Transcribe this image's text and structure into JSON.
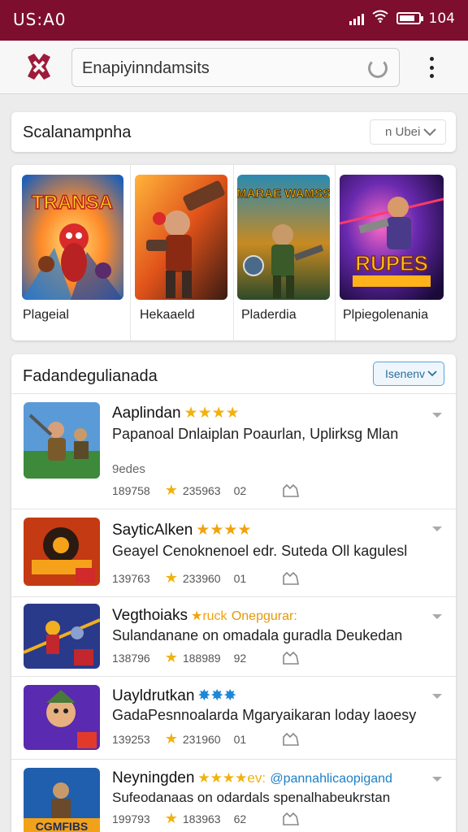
{
  "status_bar": {
    "time": "US:A0",
    "battery_text": "104"
  },
  "search": {
    "query": "Enapiyinndamsits"
  },
  "category": {
    "title": "Scalanampnha",
    "dropdown_label": "n Ubei"
  },
  "featured": [
    {
      "label": "Plageial",
      "art_title": "TRANSA",
      "palette": [
        "#1f7fd6",
        "#ff6b1a",
        "#d92b2b"
      ]
    },
    {
      "label": "Hekaaeld",
      "art_title": "",
      "palette": [
        "#f28a1a",
        "#8a2a12",
        "#3a2a22"
      ]
    },
    {
      "label": "Pladerdia",
      "art_title": "MARAE WAMSS",
      "palette": [
        "#1a6a8a",
        "#e0a020",
        "#2d5a2a"
      ]
    },
    {
      "label": "Plpiegolenania",
      "art_title": "RUPES",
      "palette": [
        "#3a1a6a",
        "#ff4db8",
        "#f5c21a"
      ]
    }
  ],
  "list": {
    "heading": "Fadandegulianada",
    "button_label": "Isenenv",
    "items": [
      {
        "name": "Aaplindan",
        "rating_text": "★★★★",
        "rating_color": "#f2b10c",
        "desc": "Papanoal Dnlaiplan Poaurlan, Uplirksg Mlan",
        "sub": "9edes",
        "downloads": "189758",
        "score": "235963",
        "version": "02",
        "thumb": [
          "#2e6ea6",
          "#7a5a2a",
          "#3c8a3a"
        ]
      },
      {
        "name": "SayticAlken",
        "rating_text": "★★★★",
        "rating_color": "#f2a20c",
        "desc": "Geayel Cenoknenoel edr. Suteda Oll kagulesl",
        "sub": "",
        "downloads": "139763",
        "score": "233960",
        "version": "01",
        "thumb": [
          "#c43a12",
          "#2a1a12",
          "#f5a21a"
        ]
      },
      {
        "name": "Vegthoiaks",
        "rating_text": "★ruck",
        "tag": "Onepgurar:",
        "rating_color": "#f2a20c",
        "desc": "Sulandanane on omadala guradla Deukedan",
        "sub": "",
        "downloads": "138796",
        "score": "188989",
        "version": "92",
        "thumb": [
          "#2a3a8a",
          "#f0b020",
          "#c2272d"
        ]
      },
      {
        "name": "Uayldrutkan",
        "rating_text": "✸✸✸",
        "rating_color": "#1e88d6",
        "desc": "GadaPesnnoalarda Mgaryaikaran loday laoesy",
        "sub": "",
        "downloads": "139253",
        "score": "231960",
        "version": "01",
        "thumb": [
          "#5a2ab0",
          "#e23a2a",
          "#f0c030"
        ]
      },
      {
        "name": "Neyningden",
        "rating_text": "★★★★ev:",
        "tag": "@pannahlicaopigand",
        "rating_color": "#f2b10c",
        "desc": "Sufeodanaas on odardals spenalhabeukrstan",
        "sub": "",
        "downloads": "199793",
        "score": "183963",
        "version": "62",
        "thumb": [
          "#1f5fae",
          "#6a4a2a",
          "#f2a21a"
        ],
        "thumb_caption": "CGMFIBS"
      }
    ]
  }
}
